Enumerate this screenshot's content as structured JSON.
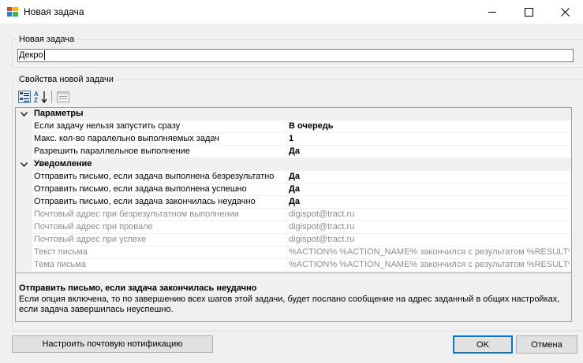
{
  "window": {
    "title": "Новая задача"
  },
  "name_group": {
    "legend": "Новая задача",
    "value": "Декро"
  },
  "props_group": {
    "legend": "Свойства новой задачи"
  },
  "grid": {
    "categories": [
      {
        "label": "Параметры",
        "rows": [
          {
            "name": "Если задачу нельзя запустить сразу",
            "value": "В очередь",
            "bold": true,
            "readonly": false
          },
          {
            "name": "Макс. кол-во паралельно выполняемых задач",
            "value": "1",
            "bold": true,
            "readonly": false
          },
          {
            "name": "Разрешить параллельное выполнение",
            "value": "Да",
            "bold": true,
            "readonly": false
          }
        ]
      },
      {
        "label": "Уведомление",
        "rows": [
          {
            "name": "Отправить письмо, если задача выполнена безрезультатно",
            "value": "Да",
            "bold": true,
            "readonly": false
          },
          {
            "name": "Отправить письмо, если задача выполнена успешно",
            "value": "Да",
            "bold": true,
            "readonly": false
          },
          {
            "name": "Отправить письмо, если задача закончилась неудачно",
            "value": "Да",
            "bold": true,
            "readonly": false
          },
          {
            "name": "Почтовый адрес при безрезультатном выполнении",
            "value": "digispot@tract.ru",
            "bold": false,
            "readonly": true
          },
          {
            "name": "Почтовый адрес при провале",
            "value": "digispot@tract.ru",
            "bold": false,
            "readonly": true
          },
          {
            "name": "Почтовый адрес при успехе",
            "value": "digispot@tract.ru",
            "bold": false,
            "readonly": true
          },
          {
            "name": "Текст письма",
            "value": "%ACTION% %ACTION_NAME% закончился с результатом %RESULT%",
            "bold": false,
            "readonly": true
          },
          {
            "name": "Тема письма",
            "value": "%ACTION% %ACTION_NAME% закончился с результатом %RESULT%",
            "bold": false,
            "readonly": true
          }
        ]
      }
    ]
  },
  "description": {
    "title": "Отправить письмо, если задача закончилась неудачно",
    "text": "Если опция включена, то по завершению всех шагов этой задачи, будет послано сообщение на адрес заданный в общих настройках, если задача завершилась неуспешно."
  },
  "buttons": {
    "notify": "Настроить почтовую нотификацию",
    "ok": "OK",
    "cancel": "Отмена"
  },
  "icons": {
    "app": "app-window-icon",
    "categorized": "categorized-view-icon",
    "alphabetical": "alphabetical-sort-icon",
    "property_pages": "property-pages-icon",
    "expander": "chevron-down-icon"
  },
  "colors": {
    "accent": "#0078d7",
    "readonly_text": "#8d8d8d",
    "dialog_bg": "#f0f0f0"
  }
}
